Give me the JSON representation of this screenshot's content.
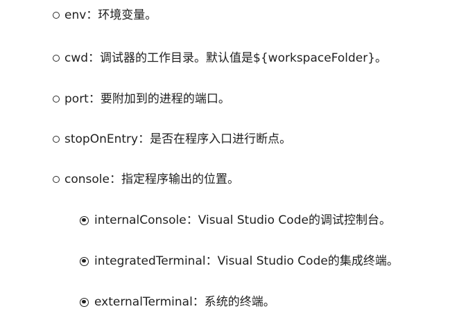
{
  "items": [
    {
      "key": "env",
      "sep": "：",
      "desc": "环境变量。"
    },
    {
      "key": "cwd",
      "sep": "：",
      "desc": "调试器的工作目录。默认值是${workspaceFolder}。"
    },
    {
      "key": "port",
      "sep": "：",
      "desc": "要附加到的进程的端口。"
    },
    {
      "key": "stopOnEntry",
      "sep": "：",
      "desc": "是否在程序入口进行断点。"
    },
    {
      "key": "console",
      "sep": "：",
      "desc": "指定程序输出的位置。"
    }
  ],
  "sub_items": [
    {
      "key": "internalConsole",
      "sep": "：",
      "desc": "Visual Studio Code的调试控制台。"
    },
    {
      "key": "integratedTerminal",
      "sep": "：",
      "desc": "Visual Studio Code的集成终端。"
    },
    {
      "key": "externalTerminal",
      "sep": "：",
      "desc": "系统的终端。"
    }
  ]
}
